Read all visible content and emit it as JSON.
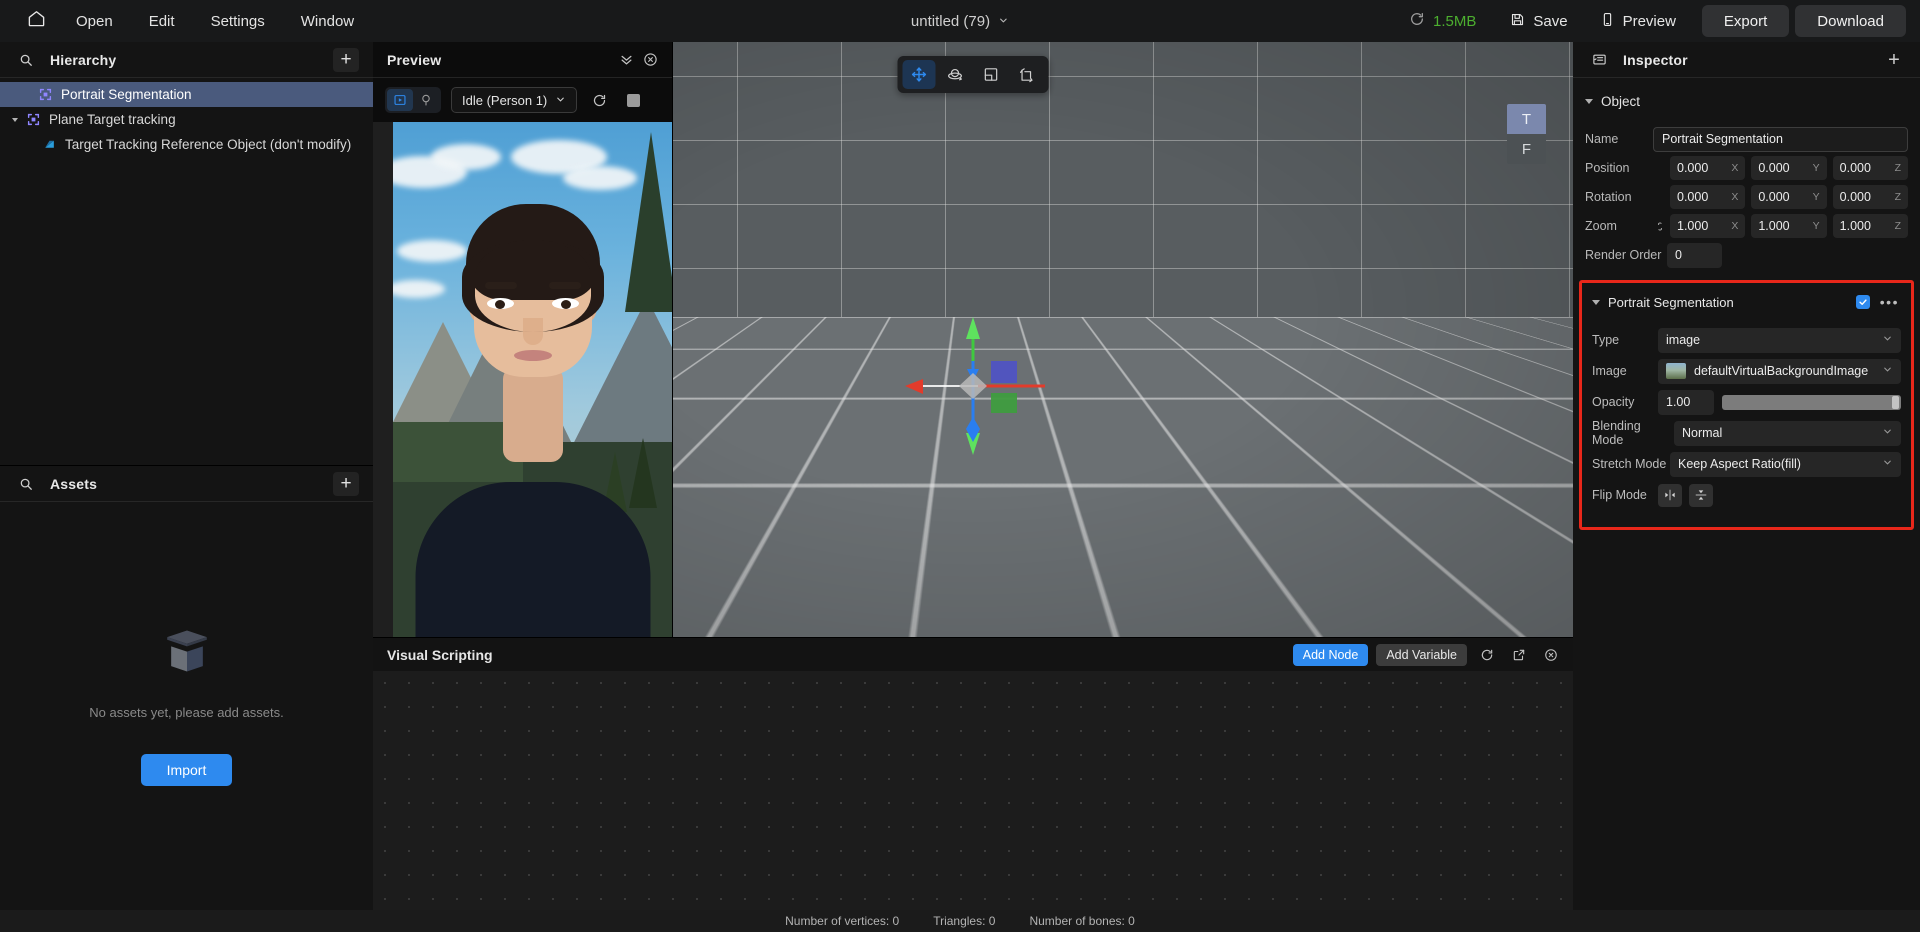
{
  "topbar": {
    "home_icon": "home-icon",
    "menus": [
      "Open",
      "Edit",
      "Settings",
      "Window"
    ],
    "title": "untitled (79)",
    "memory": "1.5MB",
    "memory_color": "#4caf2f",
    "refresh_icon": "refresh-icon",
    "save_label": "Save",
    "preview_label": "Preview",
    "export_label": "Export",
    "download_label": "Download"
  },
  "hierarchy": {
    "title": "Hierarchy",
    "search_icon": "search-icon",
    "add_icon": "plus-icon",
    "items": [
      {
        "label": "Portrait Segmentation",
        "depth": 0,
        "selected": true,
        "expandable": false
      },
      {
        "label": "Plane Target tracking",
        "depth": 0,
        "selected": false,
        "expandable": true
      },
      {
        "label": "Target Tracking Reference Object (don't modify)",
        "depth": 1,
        "selected": false,
        "expandable": false
      }
    ]
  },
  "assets": {
    "title": "Assets",
    "search_icon": "search-icon",
    "add_icon": "plus-icon",
    "empty_text": "No assets yet, please add assets.",
    "import_label": "Import"
  },
  "preview": {
    "title": "Preview",
    "collapse_icon": "chevron-double-down-icon",
    "close_icon": "close-circle-icon",
    "mode_video_icon": "video-play-icon",
    "mode_camera_icon": "camera-icon",
    "state_label": "Idle (Person 1)",
    "refresh_icon": "refresh-icon",
    "stop_icon": "stop-square-icon"
  },
  "viewport": {
    "tools": [
      {
        "name": "move-tool",
        "icon": "move-arrows-icon",
        "active": true
      },
      {
        "name": "rotate-tool",
        "icon": "rotate-orbit-icon",
        "active": false
      },
      {
        "name": "scale-tool",
        "icon": "scale-square-icon",
        "active": false
      },
      {
        "name": "transform-tool",
        "icon": "axis-transform-icon",
        "active": false
      }
    ],
    "tf_widget": {
      "top": "T",
      "bottom": "F"
    }
  },
  "visual_scripting": {
    "title": "Visual Scripting",
    "add_node_label": "Add Node",
    "add_variable_label": "Add Variable",
    "refresh_icon": "refresh-icon",
    "popout_icon": "external-link-icon",
    "close_icon": "close-circle-icon"
  },
  "inspector": {
    "title": "Inspector",
    "panel_icon": "inspector-list-icon",
    "add_icon": "plus-icon",
    "object": {
      "section_label": "Object",
      "name_label": "Name",
      "name_value": "Portrait Segmentation",
      "position_label": "Position",
      "position": {
        "x": "0.000",
        "y": "0.000",
        "z": "0.000"
      },
      "rotation_label": "Rotation",
      "rotation": {
        "x": "0.000",
        "y": "0.000",
        "z": "0.000"
      },
      "zoom_label": "Zoom",
      "zoom": {
        "x": "1.000",
        "y": "1.000",
        "z": "1.000"
      },
      "render_order_label": "Render Order",
      "render_order_value": "0",
      "axis_x": "X",
      "axis_y": "Y",
      "axis_z": "Z"
    },
    "component": {
      "highlight_color": "#e8271a",
      "title": "Portrait Segmentation",
      "enabled": true,
      "more_icon": "ellipsis-icon",
      "type_label": "Type",
      "type_value": "image",
      "image_label": "Image",
      "image_value": "defaultVirtualBackgroundImage",
      "opacity_label": "Opacity",
      "opacity_value": "1.00",
      "opacity_percent": 100,
      "blending_label": "Blending Mode",
      "blending_value": "Normal",
      "stretch_label": "Stretch Mode",
      "stretch_value": "Keep Aspect Ratio(fill)",
      "flip_label": "Flip Mode",
      "flip_horizontal_icon": "flip-horizontal-icon",
      "flip_vertical_icon": "flip-vertical-icon"
    }
  },
  "statusbar": {
    "vertices": "Number of vertices: 0",
    "triangles": "Triangles: 0",
    "bones": "Number of bones: 0"
  }
}
